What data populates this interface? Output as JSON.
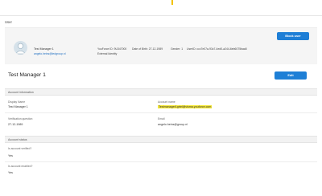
{
  "breadcrumb": "User",
  "profile": {
    "name": "Test Manager 1",
    "email": "angelo.heins@ledgroup.nl",
    "youforce_id": "YouForce ID: 9U347000",
    "birth": "Date of Birth: 27-12-1989",
    "gender": "Gender: 1",
    "user_id": "UserID: ccc7e07a-93c7-4ed0-a244-6eb6075baa5",
    "external": "External Identity",
    "block_label": "Block user"
  },
  "page": {
    "title": "Test Manager 1",
    "edit_label": "Edit"
  },
  "account_info": {
    "header": "Account information",
    "display_name_label": "Display Name",
    "display_name_value": "Test Manager 1",
    "account_name_label": "Account name",
    "account_name_value": "Testmanager1grtel@visma.youforce.com",
    "verification_label": "Verification question",
    "verification_value": "27-12-1989",
    "email_label": "Email",
    "email_value": "angelo.heins@group.nl"
  },
  "account_status": {
    "header": "Account status",
    "verified_label": "Is account verified?",
    "verified_value": "Yes",
    "enabled_label": "Is account enabled?",
    "enabled_value": "Yes"
  },
  "colors": {
    "accent": "#1e7fd6",
    "highlight": "#f5e83a",
    "top_marker": "#f2c200"
  }
}
